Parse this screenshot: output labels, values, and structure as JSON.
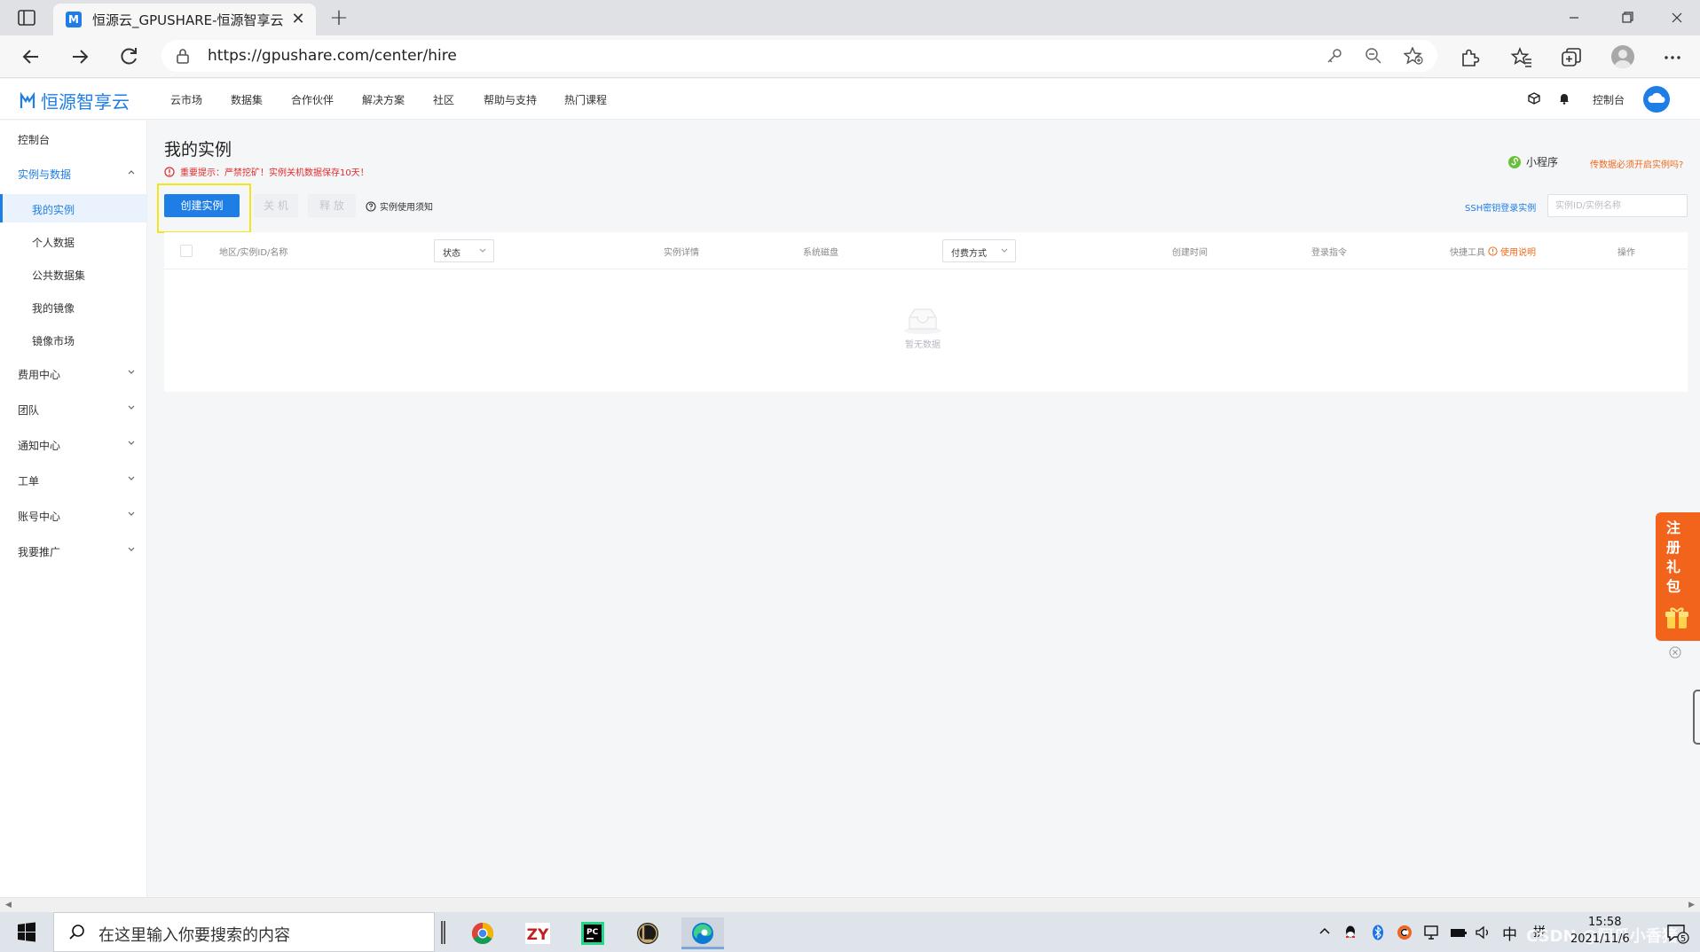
{
  "browser": {
    "tab_title": "恒源云_GPUSHARE-恒源智享云",
    "tab_favicon": "M",
    "new_tab_label": "+",
    "url": "https://gpushare.com/center/hire",
    "icons": [
      "tab-actions-icon",
      "back-icon",
      "forward-icon",
      "refresh-icon",
      "lock-icon",
      "key-icon",
      "zoom-out-icon",
      "add-favorite-icon",
      "extensions-icon",
      "favorites-icon",
      "collections-icon",
      "profile-icon",
      "more-icon"
    ]
  },
  "site_header": {
    "logo_text": "恒源智享云",
    "nav": [
      "云市场",
      "数据集",
      "合作伙伴",
      "解决方案",
      "社区",
      "帮助与支持",
      "热门课程"
    ],
    "console_label": "控制台"
  },
  "sidebar": {
    "items": [
      {
        "label": "控制台"
      },
      {
        "label": "实例与数据",
        "expanded": true
      },
      {
        "label": "我的实例",
        "active": true
      },
      {
        "label": "个人数据"
      },
      {
        "label": "公共数据集"
      },
      {
        "label": "我的镜像"
      },
      {
        "label": "镜像市场"
      },
      {
        "label": "费用中心"
      },
      {
        "label": "团队"
      },
      {
        "label": "通知中心"
      },
      {
        "label": "工单"
      },
      {
        "label": "账号中心"
      },
      {
        "label": "我要推广"
      }
    ]
  },
  "main": {
    "title": "我的实例",
    "notice": "重要提示：严禁挖矿！实例关机数据保存10天！",
    "miniprogram_label": "小程序",
    "upload_link": "传数据必须开启实例吗?",
    "buttons": {
      "create": "创建实例",
      "shutdown": "关 机",
      "release": "释 放"
    },
    "notes_link": "实例使用须知",
    "ssh_link": "SSH密钥登录实例",
    "search_placeholder": "实例ID/实例名称",
    "table": {
      "col_region": "地区/实例ID/名称",
      "status_select": "状态",
      "col_detail": "实例详情",
      "col_disk": "系统磁盘",
      "payment_select": "付费方式",
      "col_created": "创建时间",
      "col_login": "登录指令",
      "col_tools": "快捷工具",
      "tools_help": "使用说明",
      "col_actions": "操作",
      "empty_text": "暂无数据"
    }
  },
  "widget": {
    "gift_text": [
      "注",
      "册",
      "礼",
      "包"
    ],
    "colors": {
      "widget_bg": "#f2641c"
    }
  },
  "taskbar": {
    "search_text": "在这里输入你要搜索的内容",
    "apps": [
      "chrome-icon",
      "zy-app-icon",
      "pycharm-icon",
      "league-icon",
      "edge-icon"
    ],
    "ime_label": "中",
    "ime_mode": "拼",
    "time": "15:58",
    "date": "2021/11/6",
    "watermark": "CSDN @阿瓜小香猪",
    "notification_count": "5"
  },
  "colors": {
    "accent": "#1e7ee6",
    "warning": "#e02b2b",
    "orange_link": "#f06a1e",
    "highlight_box": "#f2e51c",
    "miniprogram_green": "#67c23a"
  }
}
